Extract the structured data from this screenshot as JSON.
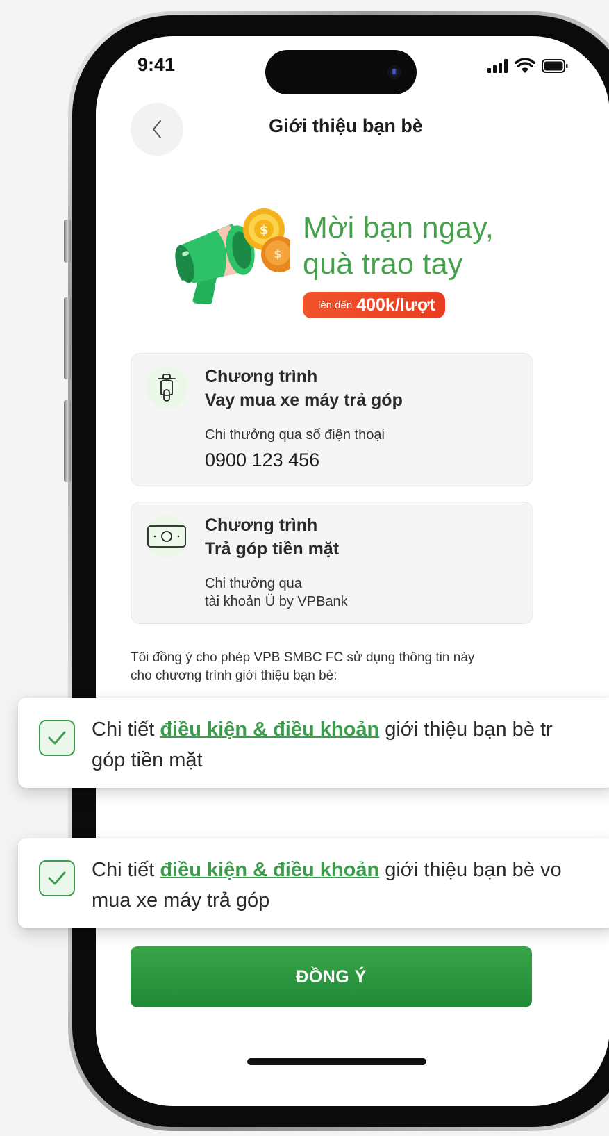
{
  "status_bar": {
    "time": "9:41"
  },
  "header": {
    "title": "Giới thiệu bạn bè"
  },
  "hero": {
    "title_line1": "Mời bạn ngay,",
    "title_line2": "quà trao tay",
    "badge_prefix": "lên đến",
    "badge_amount": "400k/lượt"
  },
  "programs": [
    {
      "label": "Chương trình",
      "name": "Vay mua xe máy trả góp",
      "reward_note": "Chi thưởng qua số điện thoại",
      "reward_value": "0900 123 456",
      "icon": "scooter-icon"
    },
    {
      "label": "Chương trình",
      "name": "Trả góp tiền mặt",
      "reward_note_line1": "Chi thưởng qua",
      "reward_note_line2": "tài khoản Ü by VPBank",
      "icon": "cash-icon"
    }
  ],
  "consent": {
    "intro_line1": "Tôi đồng ý cho phép VPB SMBC FC sử dụng thông tin này",
    "intro_line2": "cho chương trình giới thiệu bạn bè:",
    "items": [
      {
        "prefix": "Chi tiết ",
        "link": "điều kiện & điều khoản",
        "suffix_line1": " giới thiệu bạn bè tr",
        "line2": "góp tiền mặt",
        "checked": true
      },
      {
        "prefix": "Chi tiết ",
        "link": "điều kiện & điều khoản",
        "suffix_line1": " giới thiệu bạn bè vo",
        "line2": "mua xe máy trả góp",
        "checked": true
      }
    ]
  },
  "submit_button": {
    "label": "ĐỒNG Ý"
  },
  "colors": {
    "brand_green": "#45a14c",
    "badge_orange": "#ec4a26",
    "button_green": "#2a9440"
  }
}
